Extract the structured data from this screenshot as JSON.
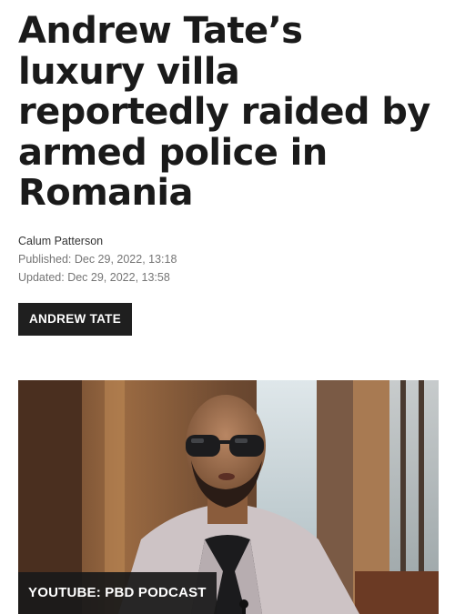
{
  "article": {
    "headline": "Andrew Tate’s luxury villa reportedly raided by armed police in Romania",
    "author": "Calum Patterson",
    "published": "Published: Dec 29, 2022, 13:18",
    "updated": "Updated: Dec 29, 2022, 13:58",
    "tag": "ANDREW TATE",
    "image_caption": "YOUTUBE: PBD PODCAST"
  },
  "colors": {
    "text": "#1a1a1a",
    "meta": "#757575",
    "tag_bg": "#1f1f1f"
  }
}
